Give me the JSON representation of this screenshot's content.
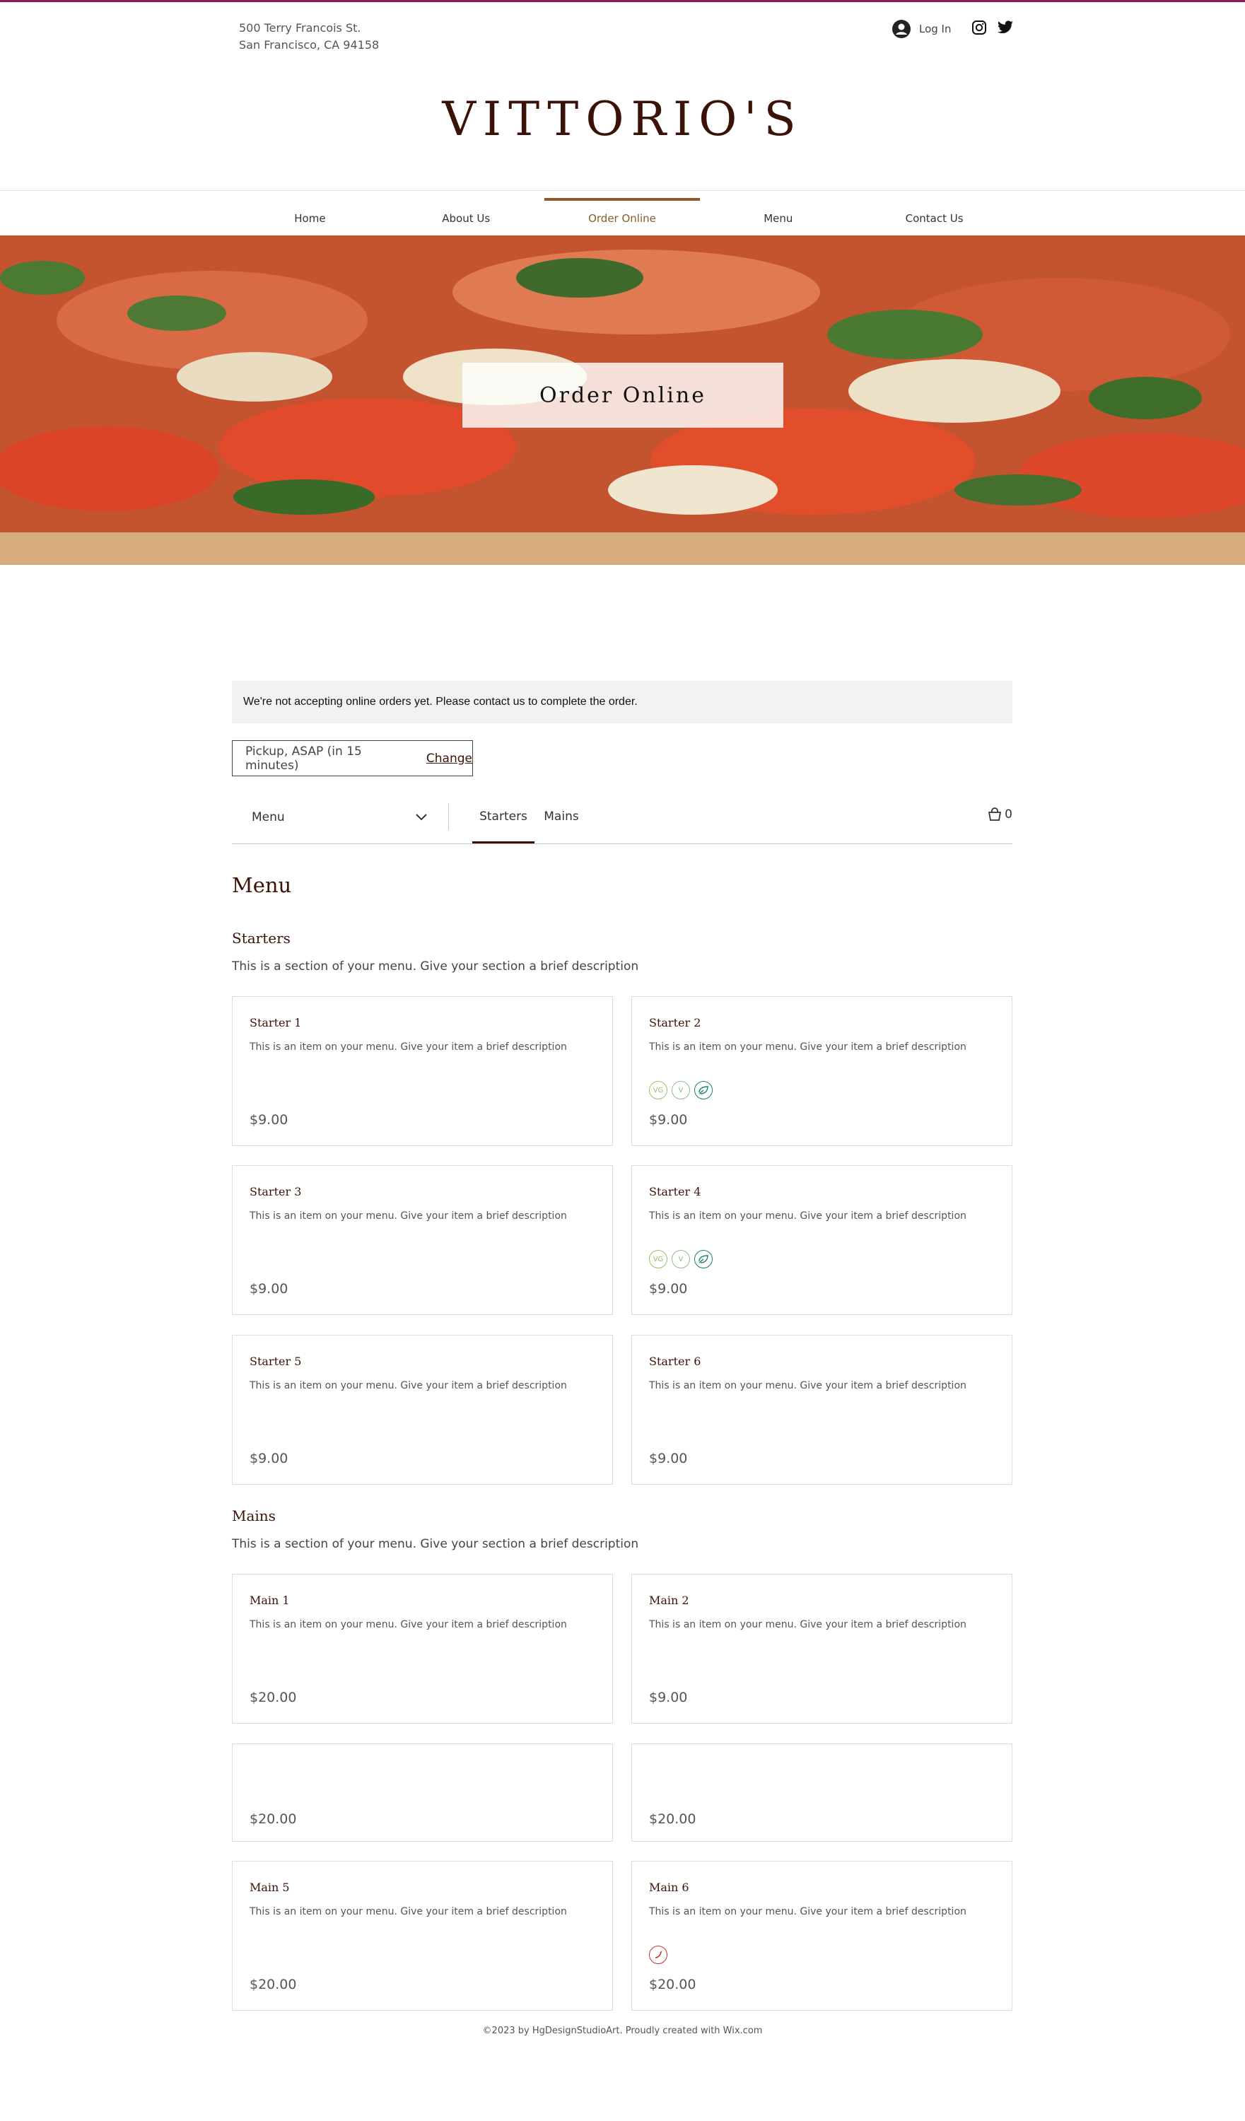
{
  "header": {
    "address_line1": "500 Terry Francois St.",
    "address_line2": "San Francisco, CA 94158",
    "login_label": "Log In",
    "logo": "VITTORIO'S",
    "socials": [
      "instagram-icon",
      "twitter-icon"
    ]
  },
  "nav": {
    "items": [
      "Home",
      "About Us",
      "Order Online",
      "Menu",
      "Contact Us"
    ],
    "active": "Order Online"
  },
  "hero": {
    "title": "Order Online"
  },
  "notice": "We're not accepting online orders yet. Please contact us to complete the order.",
  "pickup": {
    "text": "Pickup, ASAP (in 15 minutes)",
    "change_label": "Change"
  },
  "menubar": {
    "menu_select": "Menu",
    "tabs": [
      "Starters",
      "Mains"
    ],
    "active_tab": "Starters",
    "cart_count": "0"
  },
  "menu_title": "Menu",
  "sections": [
    {
      "title": "Starters",
      "description": "This is a section of your menu. Give your section a brief description",
      "items": [
        {
          "name": "Starter 1",
          "description": "This is an item on your menu. Give your item a brief description",
          "price": "$9.00",
          "badges": []
        },
        {
          "name": "Starter 2",
          "description": "This is an item on your menu. Give your item a brief description",
          "price": "$9.00",
          "badges": [
            "VG",
            "V",
            "leaf"
          ]
        },
        {
          "name": "Starter 3",
          "description": "This is an item on your menu. Give your item a brief description",
          "price": "$9.00",
          "badges": []
        },
        {
          "name": "Starter 4",
          "description": "This is an item on your menu. Give your item a brief description",
          "price": "$9.00",
          "badges": [
            "VG",
            "V",
            "leaf"
          ]
        },
        {
          "name": "Starter 5",
          "description": "This is an item on your menu. Give your item a brief description",
          "price": "$9.00",
          "badges": []
        },
        {
          "name": "Starter 6",
          "description": "This is an item on your menu. Give your item a brief description",
          "price": "$9.00",
          "badges": []
        }
      ]
    },
    {
      "title": "Mains",
      "description": "This is a section of your menu. Give your section a brief description",
      "items": [
        {
          "name": "Main 1",
          "description": "This is an item on your menu. Give your item a brief description",
          "price": "$20.00",
          "badges": []
        },
        {
          "name": "Main 2",
          "description": "This is an item on your menu. Give your item a brief description",
          "price": "$9.00",
          "badges": []
        },
        {
          "name": "",
          "description": "",
          "price": "$20.00",
          "badges": []
        },
        {
          "name": "",
          "description": "",
          "price": "$20.00",
          "badges": []
        },
        {
          "name": "Main 5",
          "description": "This is an item on your menu. Give your item a brief description",
          "price": "$20.00",
          "badges": []
        },
        {
          "name": "Main 6",
          "description": "This is an item on your menu. Give your item a brief description",
          "price": "$20.00",
          "badges": [
            "chili"
          ]
        }
      ]
    }
  ],
  "badge_legend": {
    "VG": "VG",
    "V": "V"
  },
  "colors": {
    "accent": "#8c5a2b",
    "brand": "#3a1208",
    "topline": "#8c1b5e",
    "vg": "#9bbf6a",
    "v": "#8fbf8a",
    "leaf": "#1e7f6e",
    "chili": "#c0392b"
  },
  "footer": "©2023 by HgDesignStudioArt. Proudly created with Wix.com"
}
